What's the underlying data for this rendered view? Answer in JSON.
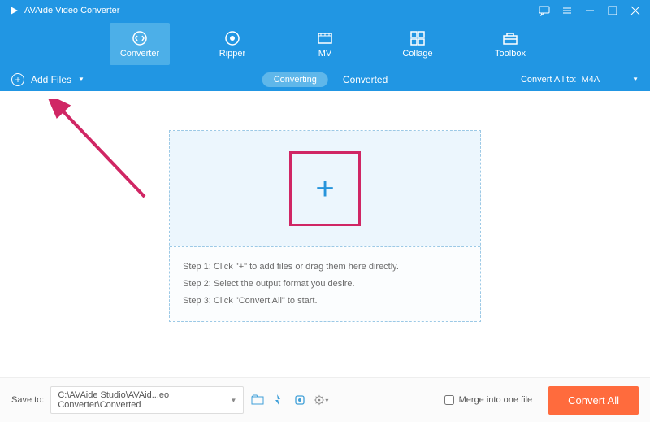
{
  "title": "AVAide Video Converter",
  "nav": {
    "converter": "Converter",
    "ripper": "Ripper",
    "mv": "MV",
    "collage": "Collage",
    "toolbox": "Toolbox"
  },
  "subbar": {
    "addFiles": "Add Files",
    "converting": "Converting",
    "converted": "Converted",
    "convertAllTo": "Convert All to:",
    "format": "M4A"
  },
  "steps": {
    "s1": "Step 1: Click \"+\" to add files or drag them here directly.",
    "s2": "Step 2: Select the output format you desire.",
    "s3": "Step 3: Click \"Convert All\" to start."
  },
  "footer": {
    "saveTo": "Save to:",
    "path": "C:\\AVAide Studio\\AVAid...eo Converter\\Converted",
    "merge": "Merge into one file",
    "convertAll": "Convert All"
  }
}
